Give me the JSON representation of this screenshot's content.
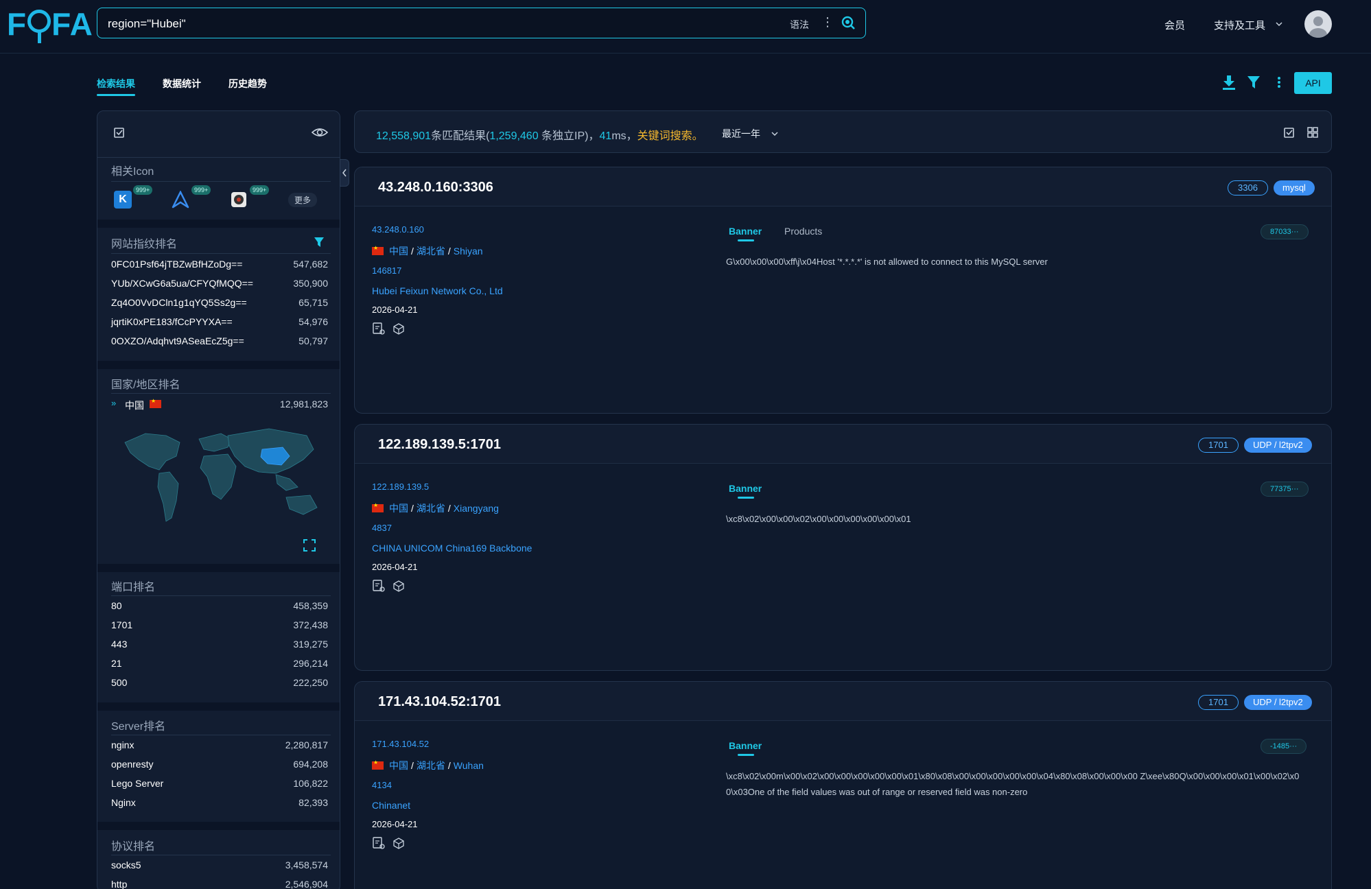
{
  "header": {
    "logo": "FOFA",
    "search_value": "region=\"Hubei\"",
    "syntax_label": "语法",
    "nav_member": "会员",
    "nav_tools": "支持及工具"
  },
  "tabs": [
    "检索结果",
    "数据统计",
    "历史趋势"
  ],
  "api_label": "API",
  "sidebar": {
    "icons_title": "相关Icon",
    "icon_badge": "999+",
    "more_label": "更多",
    "fingerprint_title": "网站指纹排名",
    "fingerprints": [
      {
        "key": "0FC01Psf64jTBZwBfHZoDg==",
        "value": "547,682"
      },
      {
        "key": "YUb/XCwG6a5ua/CFYQfMQQ==",
        "value": "350,900"
      },
      {
        "key": "Zq4O0VvDCln1g1qYQ5Ss2g==",
        "value": "65,715"
      },
      {
        "key": "jqrtiK0xPE183/fCcPYYXA==",
        "value": "54,976"
      },
      {
        "key": "0OXZO/Adqhvt9ASeaEcZ5g==",
        "value": "50,797"
      }
    ],
    "country_title": "国家/地区排名",
    "country": {
      "name": "中国",
      "value": "12,981,823"
    },
    "port_title": "端口排名",
    "ports": [
      {
        "key": "80",
        "value": "458,359"
      },
      {
        "key": "1701",
        "value": "372,438"
      },
      {
        "key": "443",
        "value": "319,275"
      },
      {
        "key": "21",
        "value": "296,214"
      },
      {
        "key": "500",
        "value": "222,250"
      }
    ],
    "server_title": "Server排名",
    "servers": [
      {
        "key": "nginx",
        "value": "2,280,817"
      },
      {
        "key": "openresty",
        "value": "694,208"
      },
      {
        "key": "Lego Server",
        "value": "106,822"
      },
      {
        "key": "Nginx",
        "value": "82,393"
      }
    ],
    "protocol_title": "协议排名",
    "protocols": [
      {
        "key": "socks5",
        "value": "3,458,574"
      },
      {
        "key": "http",
        "value": "2,546,904"
      }
    ]
  },
  "summary": {
    "total": "12,558,901",
    "total_suffix": "条匹配结果(",
    "ips": "1,259,460",
    "ips_suffix": " 条独立IP)，",
    "ms": "41",
    "ms_suffix": "ms，",
    "keyword": "关键词搜索。",
    "range": "最近一年"
  },
  "results": [
    {
      "title": "43.248.0.160:3306",
      "port_tag": "3306",
      "protocol_tag": "mysql",
      "ip": "43.248.0.160",
      "country": "中国",
      "province": "湖北省",
      "city": "Shiyan",
      "asn": "146817",
      "org": "Hubei Feixun Network Co., Ltd",
      "date": "2026-04-21",
      "banner_tab": "Banner",
      "products_tab": "Products",
      "chip": "87033···",
      "banner": "G\\x00\\x00\\x00\\xff\\j\\x04Host '*.*.*.*' is not allowed to connect to this MySQL server"
    },
    {
      "title": "122.189.139.5:1701",
      "port_tag": "1701",
      "protocol_tag": "UDP / l2tpv2",
      "ip": "122.189.139.5",
      "country": "中国",
      "province": "湖北省",
      "city": "Xiangyang",
      "asn": "4837",
      "org": "CHINA UNICOM China169 Backbone",
      "date": "2026-04-21",
      "banner_tab": "Banner",
      "products_tab": "",
      "chip": "77375···",
      "banner": "\\xc8\\x02\\x00\\x00\\x02\\x00\\x00\\x00\\x00\\x00\\x01"
    },
    {
      "title": "171.43.104.52:1701",
      "port_tag": "1701",
      "protocol_tag": "UDP / l2tpv2",
      "ip": "171.43.104.52",
      "country": "中国",
      "province": "湖北省",
      "city": "Wuhan",
      "asn": "4134",
      "org": "Chinanet",
      "date": "2026-04-21",
      "banner_tab": "Banner",
      "products_tab": "",
      "chip": "-1485···",
      "banner": "\\xc8\\x02\\x00m\\x00\\x02\\x00\\x00\\x00\\x00\\x00\\x01\\x80\\x08\\x00\\x00\\x00\\x00\\x00\\x04\\x80\\x08\\x00\\x00\\x00  Z\\xee\\x80Q\\x00\\x00\\x00\\x01\\x00\\x02\\x00\\x03One of the field values was out of range or reserved field was non-zero"
    }
  ],
  "colors": {
    "accent": "#1fc8e6",
    "link": "#3aa3ff",
    "keyword": "#f5b82e",
    "bg": "#0b1426"
  }
}
